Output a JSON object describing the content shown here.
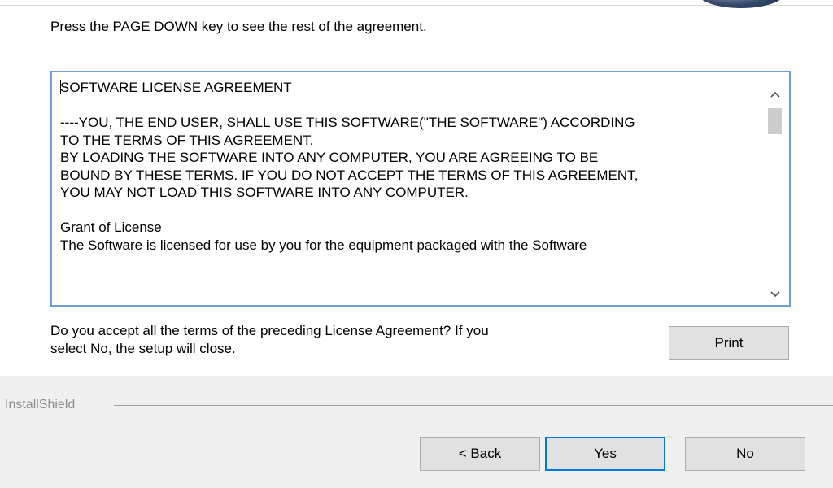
{
  "header": {
    "instruction": "Press the PAGE DOWN key to see the rest of the agreement."
  },
  "license": {
    "lines": [
      "SOFTWARE LICENSE AGREEMENT",
      "",
      "----YOU, THE END USER, SHALL USE THIS SOFTWARE(\"THE SOFTWARE\") ACCORDING",
      "TO THE TERMS OF THIS AGREEMENT.",
      "BY LOADING THE SOFTWARE INTO ANY COMPUTER, YOU ARE AGREEING TO BE",
      "BOUND BY THESE TERMS. IF YOU DO NOT ACCEPT THE TERMS OF THIS AGREEMENT,",
      "YOU MAY NOT LOAD THIS SOFTWARE INTO ANY COMPUTER.",
      "",
      "Grant of License",
      "The Software is licensed for use by you for the equipment packaged with the Software"
    ],
    "scrollbar": {
      "up_icon": "chevron-up-icon",
      "down_icon": "chevron-down-icon"
    }
  },
  "question": {
    "line1": "Do you accept all the terms of the preceding License Agreement?  If you",
    "line2": "select No,  the setup will close."
  },
  "buttons": {
    "print": "Print",
    "back": "< Back",
    "yes": "Yes",
    "no": "No"
  },
  "footer": {
    "brand": "InstallShield"
  },
  "colors": {
    "focus_border": "#0078d7",
    "text_box_border": "#6e9fd6"
  }
}
